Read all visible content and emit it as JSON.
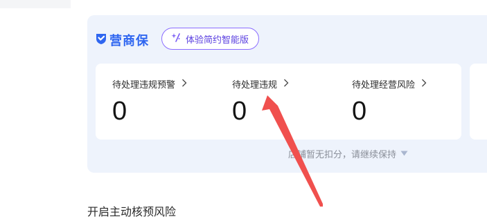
{
  "brand": {
    "name": "营商保"
  },
  "upgrade_pill": {
    "label": "体验简约智能版"
  },
  "metrics": [
    {
      "label": "待处理违规预警",
      "value": "0"
    },
    {
      "label": "待处理违规",
      "value": "0"
    },
    {
      "label": "待处理经营风险",
      "value": "0"
    }
  ],
  "status_text": "店铺暂无扣分，请继续保持",
  "next_section_title": "开启主动核预风险",
  "colors": {
    "brand_blue": "#2f66f0",
    "pill_purple": "#8a6cff",
    "annotation_arrow": "#f0504e"
  }
}
